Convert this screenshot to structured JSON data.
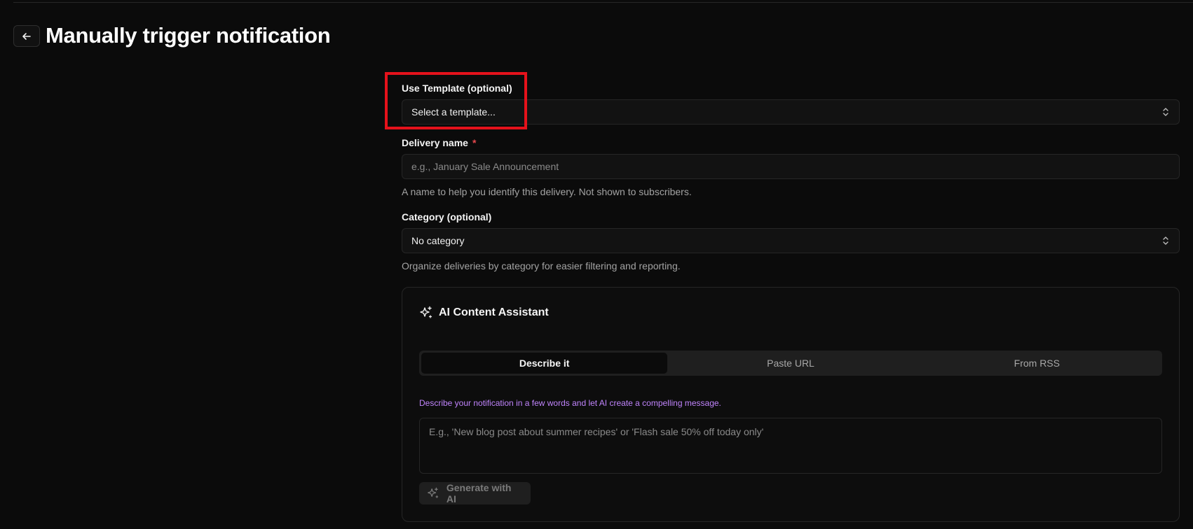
{
  "header": {
    "title": "Manually trigger notification",
    "back_icon": "arrow-left-icon"
  },
  "form": {
    "template": {
      "label": "Use Template (optional)",
      "value": "Select a template..."
    },
    "delivery_name": {
      "label": "Delivery name",
      "required_mark": "*",
      "placeholder": "e.g., January Sale Announcement",
      "value": "",
      "help": "A name to help you identify this delivery. Not shown to subscribers."
    },
    "category": {
      "label": "Category (optional)",
      "value": "No category",
      "help": "Organize deliveries by category for easier filtering and reporting."
    }
  },
  "ai_assistant": {
    "title": "AI Content Assistant",
    "icon": "sparkles-icon",
    "tabs": [
      {
        "label": "Describe it",
        "active": true
      },
      {
        "label": "Paste URL",
        "active": false
      },
      {
        "label": "From RSS",
        "active": false
      }
    ],
    "hint": "Describe your notification in a few words and let AI create a compelling message.",
    "input_placeholder": "E.g., 'New blog post about summer recipes' or 'Flash sale 50% off today only'",
    "generate_label": "Generate with AI"
  },
  "colors": {
    "background": "#0b0b0b",
    "highlight_box": "#e5121b",
    "required": "#e5484d",
    "hint_text": "#c084fc"
  }
}
